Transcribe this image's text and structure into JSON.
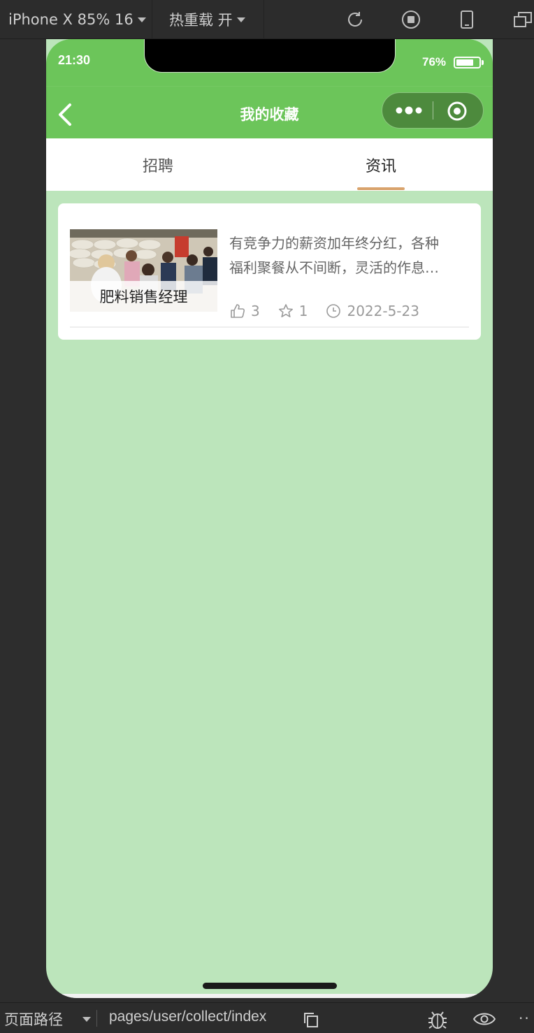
{
  "toolbar": {
    "device_label": "iPhone X 85% 16",
    "hot_reload_label": "热重载 开"
  },
  "status_bar": {
    "time": "21:30",
    "battery_percent": "76%",
    "battery_level": 0.76
  },
  "nav": {
    "title": "我的收藏"
  },
  "tabs": [
    {
      "label": "招聘",
      "active": false
    },
    {
      "label": "资讯",
      "active": true
    }
  ],
  "articles": [
    {
      "thumbnail_caption": "肥料销售经理",
      "summary_line1": "有竞争力的薪资加年终分红，各种",
      "summary_line2": "福利聚餐从不间断，灵活的作息…",
      "likes": "3",
      "favorites": "1",
      "date": "2022-5-23"
    }
  ],
  "bottom_bar": {
    "path_label": "页面路径",
    "path_value": "pages/user/collect/index",
    "more": "··"
  },
  "colors": {
    "nav_green": "#6cc55a",
    "page_bg": "#bce5bb",
    "tab_underline": "#d9a36c"
  },
  "icons": [
    "chevron-down-icon",
    "refresh-icon",
    "stop-icon",
    "phone-icon",
    "windows-icon",
    "back-icon",
    "more-dots-icon",
    "target-icon",
    "thumb-up-icon",
    "star-icon",
    "clock-icon",
    "copy-icon",
    "bug-icon",
    "eye-icon"
  ]
}
